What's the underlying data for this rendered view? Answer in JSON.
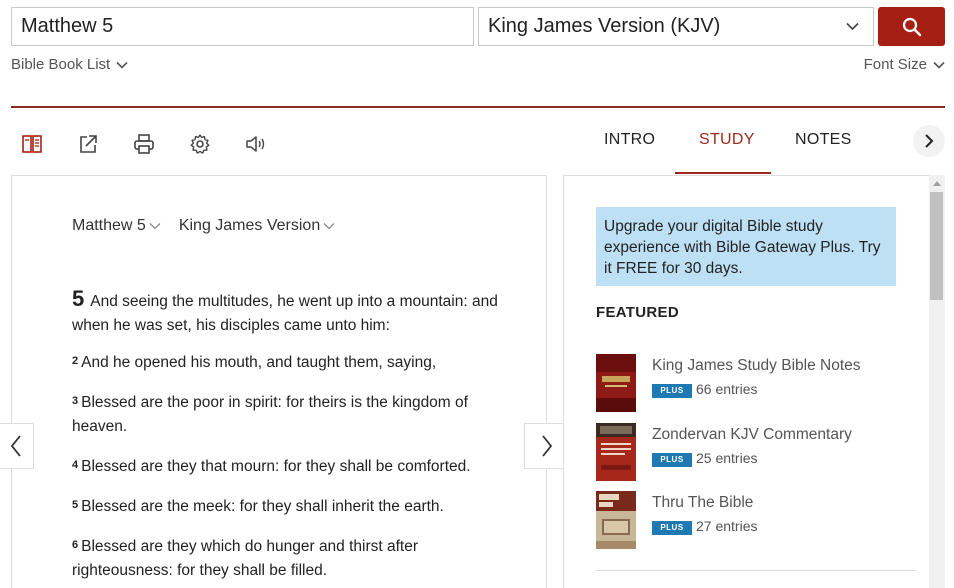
{
  "search": {
    "query": "Matthew 5"
  },
  "version_select": {
    "value": "King James Version (KJV)"
  },
  "links": {
    "book_list": "Bible Book List",
    "font_size": "Font Size"
  },
  "toolbar": {
    "icons": [
      "parallel-icon",
      "share-icon",
      "print-icon",
      "settings-icon",
      "audio-icon"
    ]
  },
  "tabs": [
    {
      "label": "INTRO"
    },
    {
      "label": "STUDY"
    },
    {
      "label": "NOTES"
    }
  ],
  "colors": {
    "accent": "#a51f12",
    "tab_active": "#9a2a1c",
    "promo_bg": "#bde0f4",
    "badge": "#1f79b3"
  },
  "passage": {
    "book_chapter": "Matthew 5",
    "version": "King James Version",
    "chapter_number": "5",
    "verses": [
      {
        "num": "",
        "text": "And seeing the multitudes, he went up into a mountain: and when he was set, his disciples came unto him:"
      },
      {
        "num": "2",
        "text": "And he opened his mouth, and taught them, saying,"
      },
      {
        "num": "3",
        "text": "Blessed are the poor in spirit: for theirs is the kingdom of heaven."
      },
      {
        "num": "4",
        "text": "Blessed are they that mourn: for they shall be comforted."
      },
      {
        "num": "5",
        "text": "Blessed are the meek: for they shall inherit the earth."
      },
      {
        "num": "6",
        "text": "Blessed are they which do hunger and thirst after righteousness: for they shall be filled."
      }
    ]
  },
  "study": {
    "promo": "Upgrade your digital Bible study experience with Bible Gateway Plus. Try it FREE for 30 days.",
    "featured_heading": "FEATURED",
    "resources": [
      {
        "title": "King James Study Bible Notes",
        "badge": "PLUS",
        "entries": "66 entries"
      },
      {
        "title": "Zondervan KJV Commentary",
        "badge": "PLUS",
        "entries": "25 entries"
      },
      {
        "title": "Thru The Bible",
        "badge": "PLUS",
        "entries": "27 entries"
      }
    ]
  }
}
